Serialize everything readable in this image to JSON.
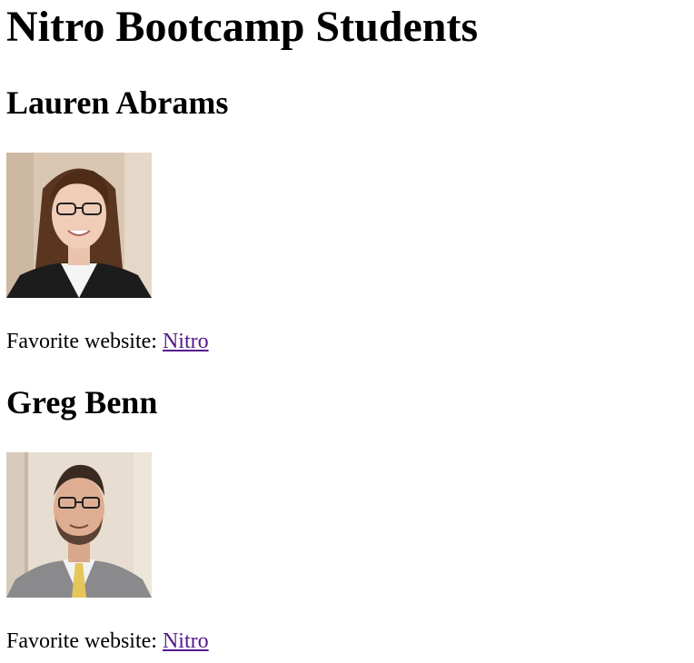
{
  "page": {
    "title": "Nitro Bootcamp Students"
  },
  "students": [
    {
      "name": "Lauren Abrams",
      "favorite_label": "Favorite website:",
      "link_text": "Nitro"
    },
    {
      "name": "Greg Benn",
      "favorite_label": "Favorite website:",
      "link_text": "Nitro"
    }
  ],
  "colors": {
    "visited_link": "#551a8b",
    "text": "#000000",
    "background": "#ffffff"
  }
}
